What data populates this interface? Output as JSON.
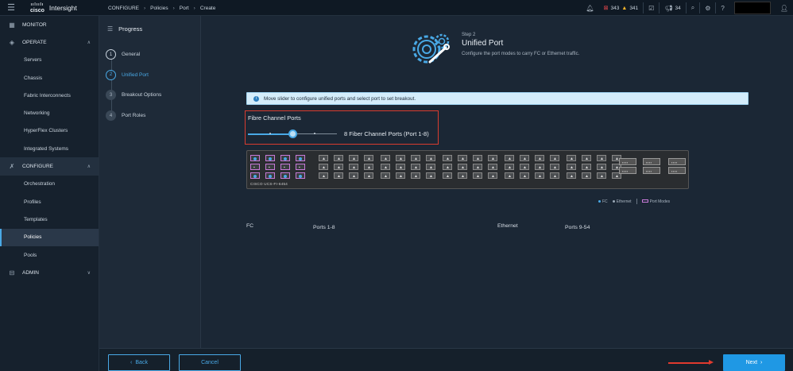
{
  "app": {
    "brand": "Intersight",
    "cisco": "cisco"
  },
  "breadcrumb": [
    "CONFIGURE",
    "Policies",
    "Port",
    "Create"
  ],
  "topbar": {
    "alarms_critical": "343",
    "alarms_warning": "341",
    "notifications": "34"
  },
  "nav": {
    "monitor": "MONITOR",
    "operate": "OPERATE",
    "operate_items": [
      "Servers",
      "Chassis",
      "Fabric Interconnects",
      "Networking",
      "HyperFlex Clusters",
      "Integrated Systems"
    ],
    "configure": "CONFIGURE",
    "configure_items": [
      "Orchestration",
      "Profiles",
      "Templates",
      "Policies",
      "Pools"
    ],
    "admin": "ADMIN"
  },
  "progress": {
    "title": "Progress",
    "steps": [
      {
        "num": "1",
        "label": "General"
      },
      {
        "num": "2",
        "label": "Unified Port"
      },
      {
        "num": "3",
        "label": "Breakout Options"
      },
      {
        "num": "4",
        "label": "Port Roles"
      }
    ]
  },
  "step": {
    "label": "Step 2",
    "title": "Unified Port",
    "description": "Configure the port modes to carry FC or Ethernet traffic."
  },
  "info": "Move slider to configure unified ports and select port to set breakout.",
  "slider": {
    "title": "Fibre Channel Ports",
    "value_text": "8 Fiber Channel Ports (Port 1-8)",
    "fc_ports": 8,
    "max_ports": 16
  },
  "switch_model": "CISCO UCS-FI-6454",
  "legend": {
    "fc": "FC",
    "ethernet": "Ethernet",
    "port_modes": "Port Modes"
  },
  "summary": {
    "fc_label": "FC",
    "fc_ports": "Ports 1-8",
    "eth_label": "Ethernet",
    "eth_ports": "Ports 9-54"
  },
  "buttons": {
    "back": "Back",
    "cancel": "Cancel",
    "next": "Next"
  },
  "colors": {
    "accent": "#49a9e6",
    "fc_port": "#c77ad8",
    "highlight": "#d93c2f"
  }
}
